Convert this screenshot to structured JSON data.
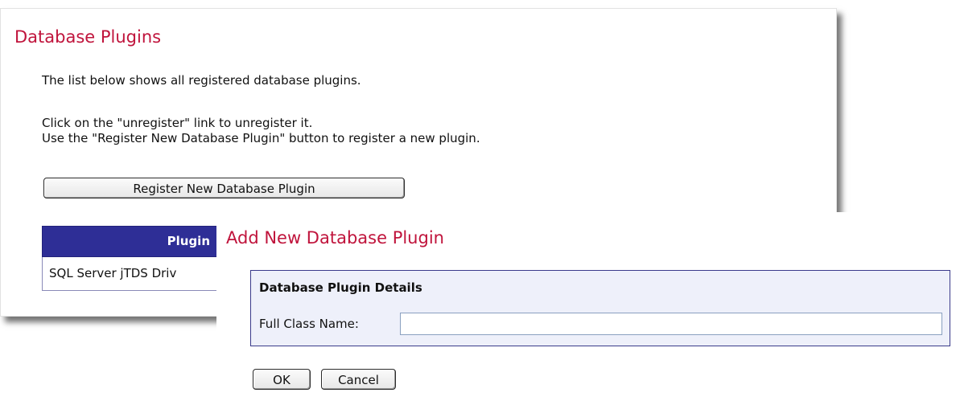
{
  "database_plugins": {
    "title": "Database Plugins",
    "intro": "The list below shows all registered database plugins.",
    "help_line_1": "Click on the \"unregister\" link to unregister it.",
    "help_line_2": "Use the \"Register New Database Plugin\" button to register a new plugin.",
    "register_button_label": "Register New Database Plugin",
    "table": {
      "columns": [
        "Plugin"
      ],
      "rows": [
        {
          "plugin": "SQL Server jTDS Driv"
        }
      ]
    }
  },
  "add_plugin": {
    "title": "Add New Database Plugin",
    "section_title": "Database Plugin Details",
    "full_class_name_label": "Full Class Name:",
    "full_class_name_value": "",
    "ok_label": "OK",
    "cancel_label": "Cancel"
  }
}
